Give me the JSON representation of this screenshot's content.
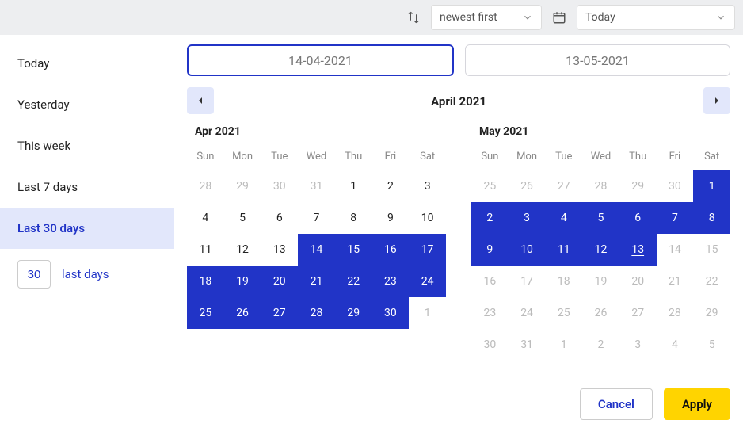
{
  "topbar": {
    "sort_label": "newest first",
    "range_label": "Today"
  },
  "sidebar": {
    "presets": [
      {
        "label": "Today",
        "active": false
      },
      {
        "label": "Yesterday",
        "active": false
      },
      {
        "label": "This week",
        "active": false
      },
      {
        "label": "Last 7 days",
        "active": false
      },
      {
        "label": "Last 30 days",
        "active": true
      }
    ],
    "last_days_value": "30",
    "last_days_label": "last days"
  },
  "date_inputs": {
    "start": "14-04-2021",
    "end": "13-05-2021"
  },
  "nav_title": "April 2021",
  "dow": [
    "Sun",
    "Mon",
    "Tue",
    "Wed",
    "Thu",
    "Fri",
    "Sat"
  ],
  "months": [
    {
      "label": "Apr 2021",
      "weeks": [
        [
          {
            "d": "28",
            "out": true
          },
          {
            "d": "29",
            "out": true
          },
          {
            "d": "30",
            "out": true
          },
          {
            "d": "31",
            "out": true
          },
          {
            "d": "1"
          },
          {
            "d": "2"
          },
          {
            "d": "3"
          }
        ],
        [
          {
            "d": "4"
          },
          {
            "d": "5"
          },
          {
            "d": "6"
          },
          {
            "d": "7"
          },
          {
            "d": "8"
          },
          {
            "d": "9"
          },
          {
            "d": "10"
          }
        ],
        [
          {
            "d": "11"
          },
          {
            "d": "12"
          },
          {
            "d": "13"
          },
          {
            "d": "14",
            "sel": true
          },
          {
            "d": "15",
            "sel": true
          },
          {
            "d": "16",
            "sel": true
          },
          {
            "d": "17",
            "sel": true
          }
        ],
        [
          {
            "d": "18",
            "sel": true
          },
          {
            "d": "19",
            "sel": true
          },
          {
            "d": "20",
            "sel": true
          },
          {
            "d": "21",
            "sel": true
          },
          {
            "d": "22",
            "sel": true
          },
          {
            "d": "23",
            "sel": true
          },
          {
            "d": "24",
            "sel": true
          }
        ],
        [
          {
            "d": "25",
            "sel": true
          },
          {
            "d": "26",
            "sel": true
          },
          {
            "d": "27",
            "sel": true
          },
          {
            "d": "28",
            "sel": true
          },
          {
            "d": "29",
            "sel": true
          },
          {
            "d": "30",
            "sel": true
          },
          {
            "d": "1",
            "out": true
          }
        ]
      ]
    },
    {
      "label": "May 2021",
      "weeks": [
        [
          {
            "d": "25",
            "out": true
          },
          {
            "d": "26",
            "out": true
          },
          {
            "d": "27",
            "out": true
          },
          {
            "d": "28",
            "out": true
          },
          {
            "d": "29",
            "out": true
          },
          {
            "d": "30",
            "out": true
          },
          {
            "d": "1",
            "sel": true
          }
        ],
        [
          {
            "d": "2",
            "sel": true
          },
          {
            "d": "3",
            "sel": true
          },
          {
            "d": "4",
            "sel": true
          },
          {
            "d": "5",
            "sel": true
          },
          {
            "d": "6",
            "sel": true
          },
          {
            "d": "7",
            "sel": true
          },
          {
            "d": "8",
            "sel": true
          }
        ],
        [
          {
            "d": "9",
            "sel": true
          },
          {
            "d": "10",
            "sel": true
          },
          {
            "d": "11",
            "sel": true
          },
          {
            "d": "12",
            "sel": true
          },
          {
            "d": "13",
            "sel": true,
            "today": true
          },
          {
            "d": "14",
            "out": true
          },
          {
            "d": "15",
            "out": true
          }
        ],
        [
          {
            "d": "16",
            "out": true
          },
          {
            "d": "17",
            "out": true
          },
          {
            "d": "18",
            "out": true
          },
          {
            "d": "19",
            "out": true
          },
          {
            "d": "20",
            "out": true
          },
          {
            "d": "21",
            "out": true
          },
          {
            "d": "22",
            "out": true
          }
        ],
        [
          {
            "d": "23",
            "out": true
          },
          {
            "d": "24",
            "out": true
          },
          {
            "d": "25",
            "out": true
          },
          {
            "d": "26",
            "out": true
          },
          {
            "d": "27",
            "out": true
          },
          {
            "d": "28",
            "out": true
          },
          {
            "d": "29",
            "out": true
          }
        ],
        [
          {
            "d": "30",
            "out": true
          },
          {
            "d": "31",
            "out": true
          },
          {
            "d": "1",
            "out": true
          },
          {
            "d": "2",
            "out": true
          },
          {
            "d": "3",
            "out": true
          },
          {
            "d": "4",
            "out": true
          },
          {
            "d": "5",
            "out": true
          }
        ]
      ]
    }
  ],
  "buttons": {
    "cancel": "Cancel",
    "apply": "Apply"
  },
  "colors": {
    "primary": "#2134c7",
    "accent": "#ffd400"
  }
}
